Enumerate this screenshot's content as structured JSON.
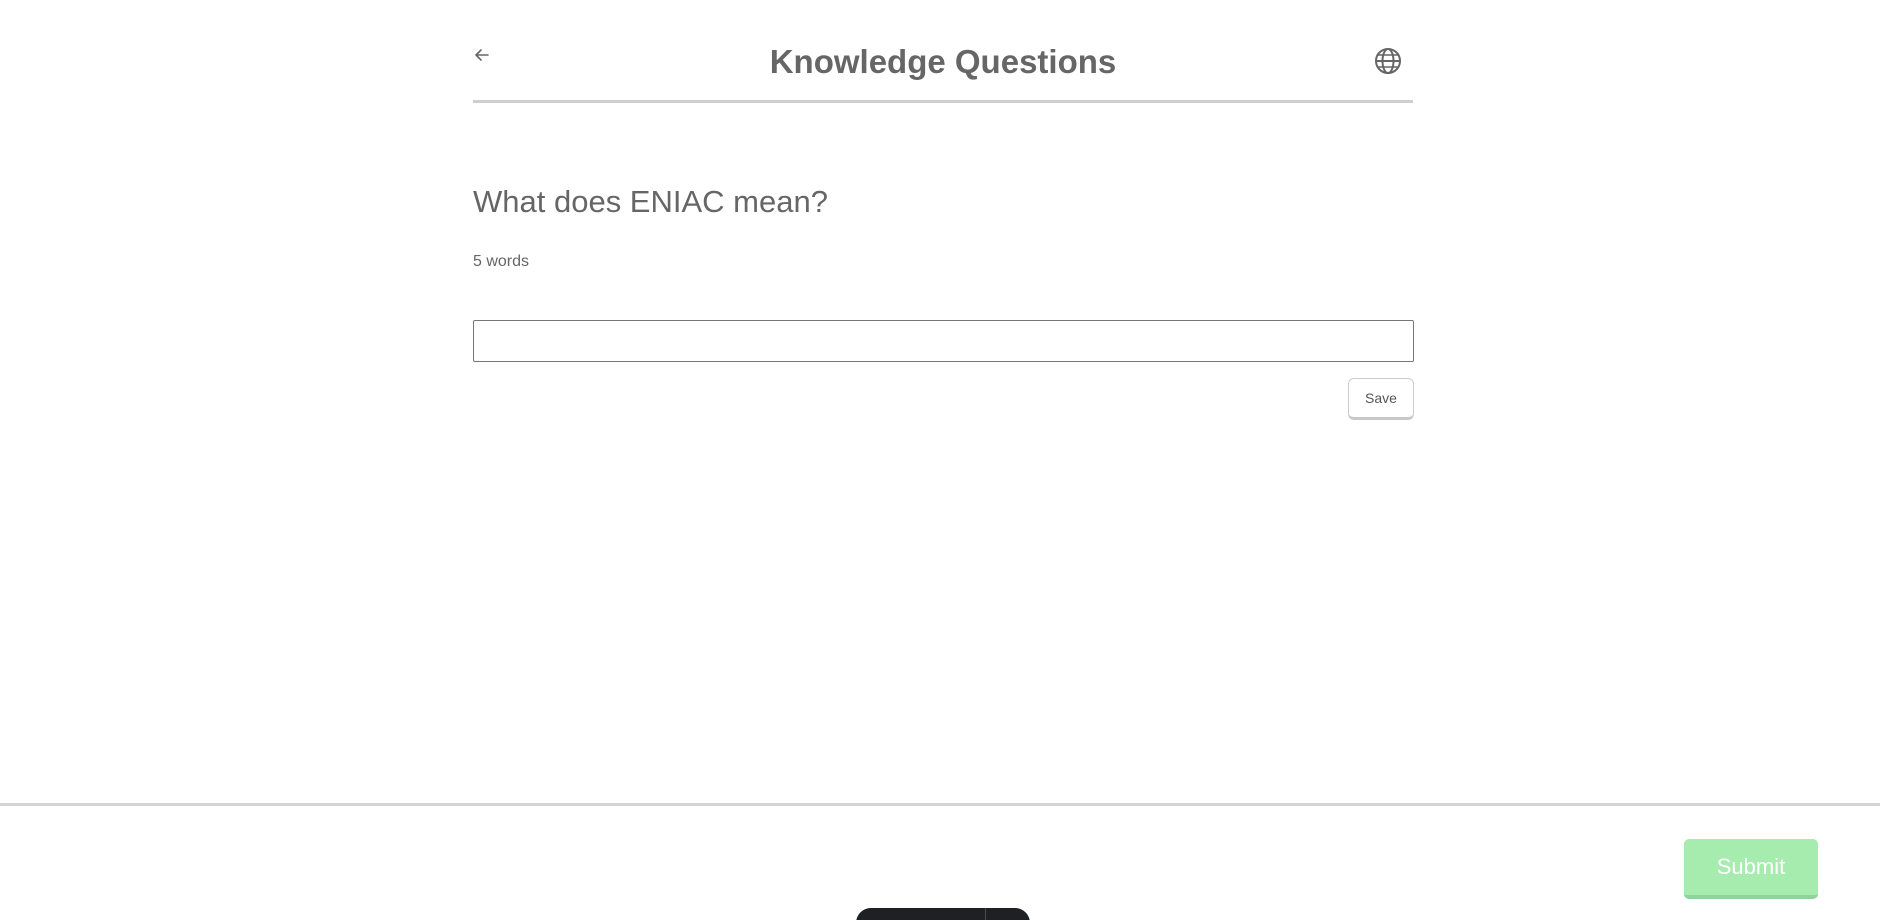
{
  "header": {
    "title": "Knowledge Questions",
    "back_icon": "arrow-left-icon",
    "language_icon": "globe-icon"
  },
  "question": {
    "text": "What does ENIAC mean?",
    "word_hint": "5 words"
  },
  "answer": {
    "value": "",
    "placeholder": ""
  },
  "actions": {
    "save_label": "Save",
    "submit_label": "Submit"
  },
  "colors": {
    "text": "#666666",
    "divider": "#cfcfcf",
    "submit_bg": "#a6ecae",
    "submit_text": "#ffffff",
    "floating_bar": "#1f2023"
  }
}
